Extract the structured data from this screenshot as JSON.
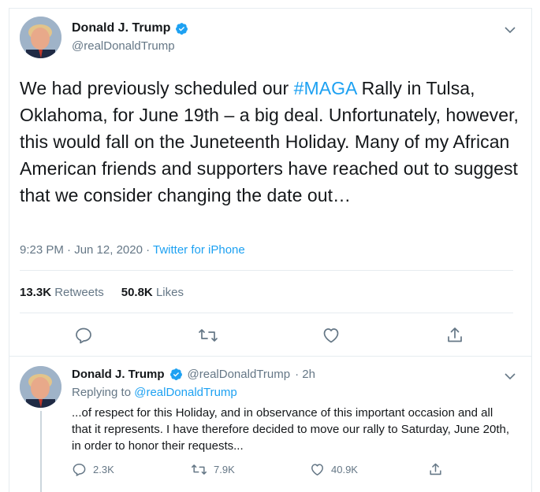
{
  "colors": {
    "accent": "#1da1f2",
    "text": "#14171a",
    "muted": "#657786",
    "border": "#e6ecf0"
  },
  "main_tweet": {
    "author_name": "Donald J. Trump",
    "handle": "@realDonaldTrump",
    "text_before_hashtag": "We had previously scheduled our ",
    "hashtag": "#MAGA",
    "text_after_hashtag": " Rally in Tulsa, Oklahoma, for June 19th – a big deal. Unfortunately, however, this would fall on the Juneteenth Holiday. Many of my African American friends and supporters have reached out to suggest that we consider changing the date out…",
    "timestamp": "9:23 PM · Jun 12, 2020 · ",
    "source": "Twitter for iPhone",
    "retweets_count": "13.3K",
    "retweets_label": "Retweets",
    "likes_count": "50.8K",
    "likes_label": "Likes",
    "icons": [
      "reply-icon",
      "retweet-icon",
      "like-icon",
      "share-icon"
    ]
  },
  "reply_tweet": {
    "author_name": "Donald J. Trump",
    "handle": "@realDonaldTrump",
    "time": "· 2h",
    "replying_label": "Replying to ",
    "replying_to": "@realDonaldTrump",
    "text": "...of respect for this Holiday, and in observance of this important occasion and all that it represents. I have therefore decided to move our rally to Saturday, June 20th, in order to honor their requests...",
    "replies_count": "2.3K",
    "retweets_count": "7.9K",
    "likes_count": "40.9K"
  }
}
